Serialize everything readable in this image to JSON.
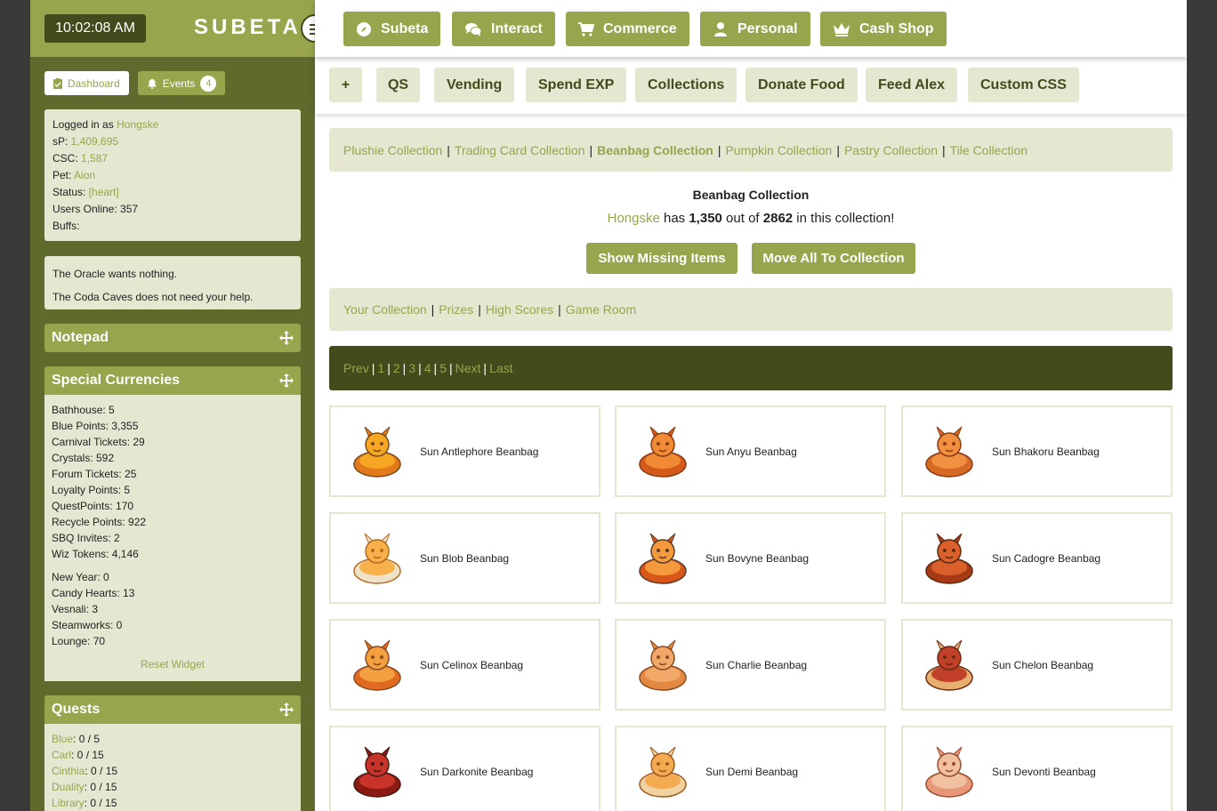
{
  "clock": "10:02:08 AM",
  "brand": "SUBETA",
  "chips": {
    "dashboard": "Dashboard",
    "events": "Events",
    "events_count": "4"
  },
  "user": {
    "logged_in_label": "Logged in as ",
    "username": "Hongske",
    "sp_label": "sP: ",
    "sp": "1,409,695",
    "csc_label": "CSC: ",
    "csc": "1,587",
    "pet_label": "Pet: ",
    "pet": "Aion",
    "status_label": "Status: ",
    "status": "[heart]",
    "online": "Users Online: 357",
    "buffs": "Buffs:"
  },
  "notices": [
    "The Oracle wants nothing.",
    "The Coda Caves does not need your help."
  ],
  "widgets": {
    "notepad": "Notepad",
    "currencies": "Special Currencies",
    "quests": "Quests"
  },
  "currencies": [
    "Bathhouse: 5",
    "Blue Points: 3,355",
    "Carnival Tickets: 29",
    "Crystals: 592",
    "Forum Tickets: 25",
    "Loyalty Points: 5",
    "QuestPoints: 170",
    "Recycle Points: 922",
    "SBQ Invites: 2",
    "Wiz Tokens: 4,146"
  ],
  "seasonal_currencies": [
    "New Year: 0",
    "Candy Hearts: 13",
    "Vesnali: 3",
    "Steamworks: 0",
    "Lounge: 70"
  ],
  "reset_widget": "Reset Widget",
  "quests": [
    {
      "name": "Blue",
      "value": ": 0 / 5"
    },
    {
      "name": "Carl",
      "value": ": 0 / 15"
    },
    {
      "name": "Cinthia",
      "value": ": 0 / 15"
    },
    {
      "name": "Duality",
      "value": ": 0 / 15"
    },
    {
      "name": "Library",
      "value": ": 0 / 15"
    }
  ],
  "topnav": [
    "Subeta",
    "Interact",
    "Commerce",
    "Personal",
    "Cash Shop"
  ],
  "subnav": [
    "+",
    "QS",
    "Vending",
    "Spend EXP",
    "Collections",
    "Donate Food",
    "Feed Alex",
    "Custom CSS"
  ],
  "collections_nav": [
    "Plushie Collection",
    "Trading Card Collection",
    "Beanbag Collection",
    "Pumpkin Collection",
    "Pastry Collection",
    "Tile Collection"
  ],
  "collection": {
    "title": "Beanbag Collection",
    "user": "Hongske",
    "has": " has ",
    "count": "1,350",
    "out_of": " out of ",
    "total": "2862",
    "suffix": " in this collection!"
  },
  "buttons": {
    "show_missing": "Show Missing Items",
    "move_all": "Move All To Collection"
  },
  "sub_links": [
    "Your Collection",
    "Prizes",
    "High Scores",
    "Game Room"
  ],
  "pager": [
    "Prev",
    "1",
    "2",
    "3",
    "4",
    "5",
    "Next",
    "Last"
  ],
  "items": [
    {
      "name": "Sun Antlephore Beanbag",
      "icon": "antlephore-beanbag-icon"
    },
    {
      "name": "Sun Anyu Beanbag",
      "icon": "anyu-beanbag-icon"
    },
    {
      "name": "Sun Bhakoru Beanbag",
      "icon": "bhakoru-beanbag-icon"
    },
    {
      "name": "Sun Blob Beanbag",
      "icon": "blob-beanbag-icon"
    },
    {
      "name": "Sun Bovyne Beanbag",
      "icon": "bovyne-beanbag-icon"
    },
    {
      "name": "Sun Cadogre Beanbag",
      "icon": "cadogre-beanbag-icon"
    },
    {
      "name": "Sun Celinox Beanbag",
      "icon": "celinox-beanbag-icon"
    },
    {
      "name": "Sun Charlie Beanbag",
      "icon": "charlie-beanbag-icon"
    },
    {
      "name": "Sun Chelon Beanbag",
      "icon": "chelon-beanbag-icon"
    },
    {
      "name": "Sun Darkonite Beanbag",
      "icon": "darkonite-beanbag-icon"
    },
    {
      "name": "Sun Demi Beanbag",
      "icon": "demi-beanbag-icon"
    },
    {
      "name": "Sun Devonti Beanbag",
      "icon": "devonti-beanbag-icon"
    }
  ],
  "colors": {
    "brand": "#98a54c",
    "dark": "#434b1c",
    "light": "#e5e7d1",
    "sidebar": "#5e6b2c"
  }
}
